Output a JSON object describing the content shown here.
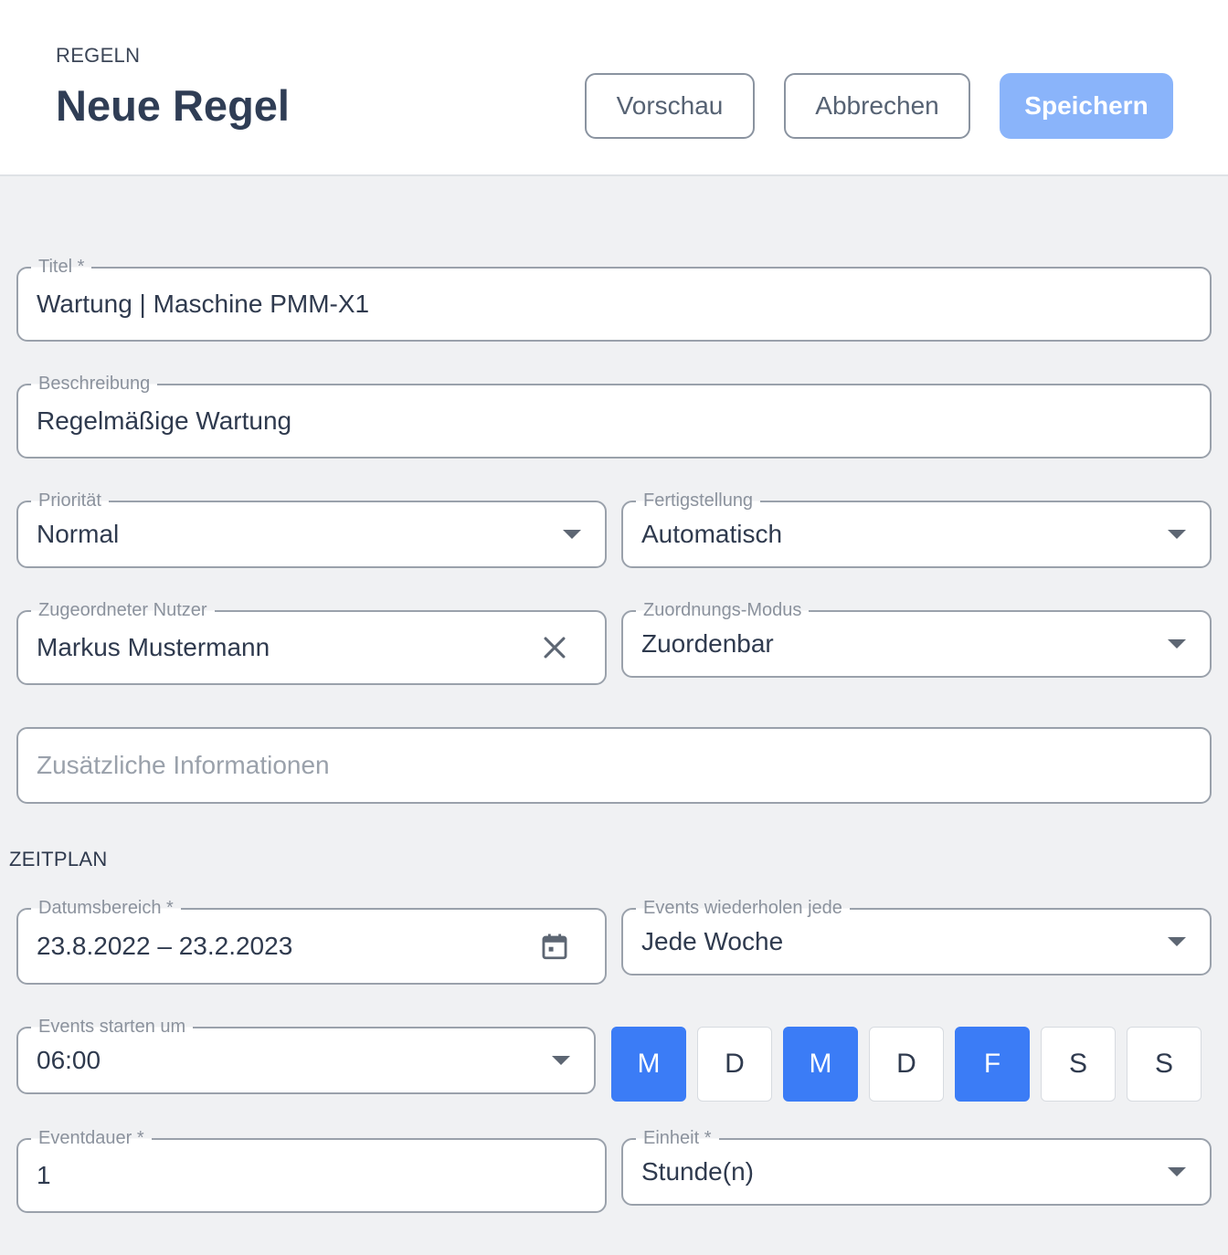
{
  "header": {
    "breadcrumb": "REGELN",
    "title": "Neue Regel",
    "preview_label": "Vorschau",
    "cancel_label": "Abbrechen",
    "save_label": "Speichern"
  },
  "form": {
    "title": {
      "label": "Titel *",
      "value": "Wartung | Maschine PMM-X1"
    },
    "description": {
      "label": "Beschreibung",
      "value": "Regelmäßige Wartung"
    },
    "priority": {
      "label": "Priorität",
      "value": "Normal"
    },
    "completion": {
      "label": "Fertigstellung",
      "value": "Automatisch"
    },
    "assigned_user": {
      "label": "Zugeordneter Nutzer",
      "value": "Markus Mustermann"
    },
    "assignment_mode": {
      "label": "Zuordnungs-Modus",
      "value": "Zuordenbar"
    },
    "additional_info": {
      "placeholder": "Zusätzliche Informationen"
    }
  },
  "schedule": {
    "section_label": "ZEITPLAN",
    "date_range": {
      "label": "Datumsbereich *",
      "value": "23.8.2022 – 23.2.2023"
    },
    "repeat": {
      "label": "Events wiederholen jede",
      "value": "Jede Woche"
    },
    "start_time": {
      "label": "Events starten um",
      "value": "06:00"
    },
    "weekdays": [
      {
        "label": "M",
        "selected": true
      },
      {
        "label": "D",
        "selected": false
      },
      {
        "label": "M",
        "selected": true
      },
      {
        "label": "D",
        "selected": false
      },
      {
        "label": "F",
        "selected": true
      },
      {
        "label": "S",
        "selected": false
      },
      {
        "label": "S",
        "selected": false
      }
    ],
    "duration": {
      "label": "Eventdauer *",
      "value": "1"
    },
    "unit": {
      "label": "Einheit *",
      "value": "Stunde(n)"
    }
  },
  "colors": {
    "accent": "#3b7cf6",
    "save_button": "#8ab4fa",
    "border": "#9aa1ab",
    "background": "#f0f1f3"
  },
  "icons": {
    "clear": "close-icon",
    "calendar": "calendar-icon",
    "dropdown": "chevron-down-icon"
  }
}
